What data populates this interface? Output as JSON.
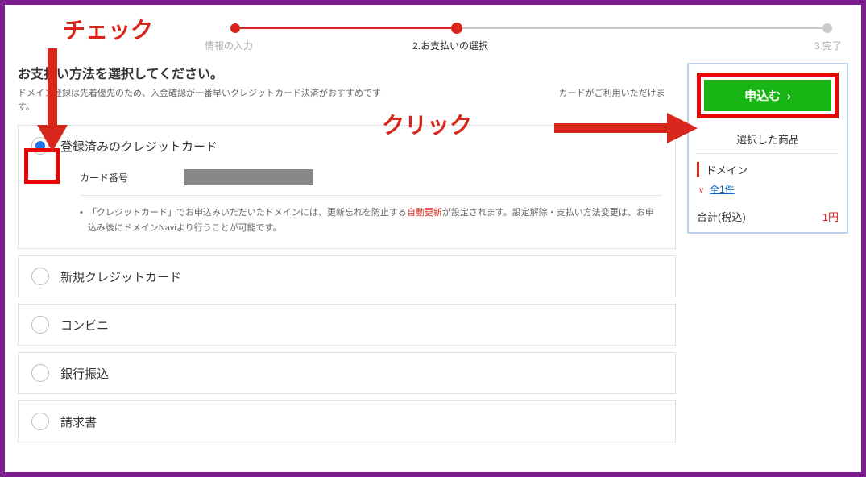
{
  "progress": {
    "step1": "情報の入力",
    "step2": "2.お支払いの選択",
    "step3": "3.完了"
  },
  "section": {
    "title": "お支払い方法を選択してください。",
    "desc_a": "ドメイン登録は先着優先のため、入金確認が一番早いクレジットカード決済がおすすめです",
    "desc_b": "カードがご利用いただけます。"
  },
  "options": {
    "registered_card": "登録済みのクレジットカード",
    "card_no_label": "カード番号",
    "note_a": "「クレジットカード」でお申込みいただいたドメインには、更新忘れを防止する",
    "note_red": "自動更新",
    "note_b": "が設定されます。設定解除・支払い方法変更は、お申込み後にドメインNaviより行うことが可能です。",
    "new_card": "新規クレジットカード",
    "conv": "コンビニ",
    "bank": "銀行振込",
    "invoice": "請求書"
  },
  "summary": {
    "apply": "申込む",
    "title": "選択した商品",
    "domain_label": "ドメイン",
    "expand": "全1件",
    "total_label": "合計(税込)",
    "total_value": "1円"
  },
  "anno": {
    "check": "チェック",
    "click": "クリック"
  }
}
